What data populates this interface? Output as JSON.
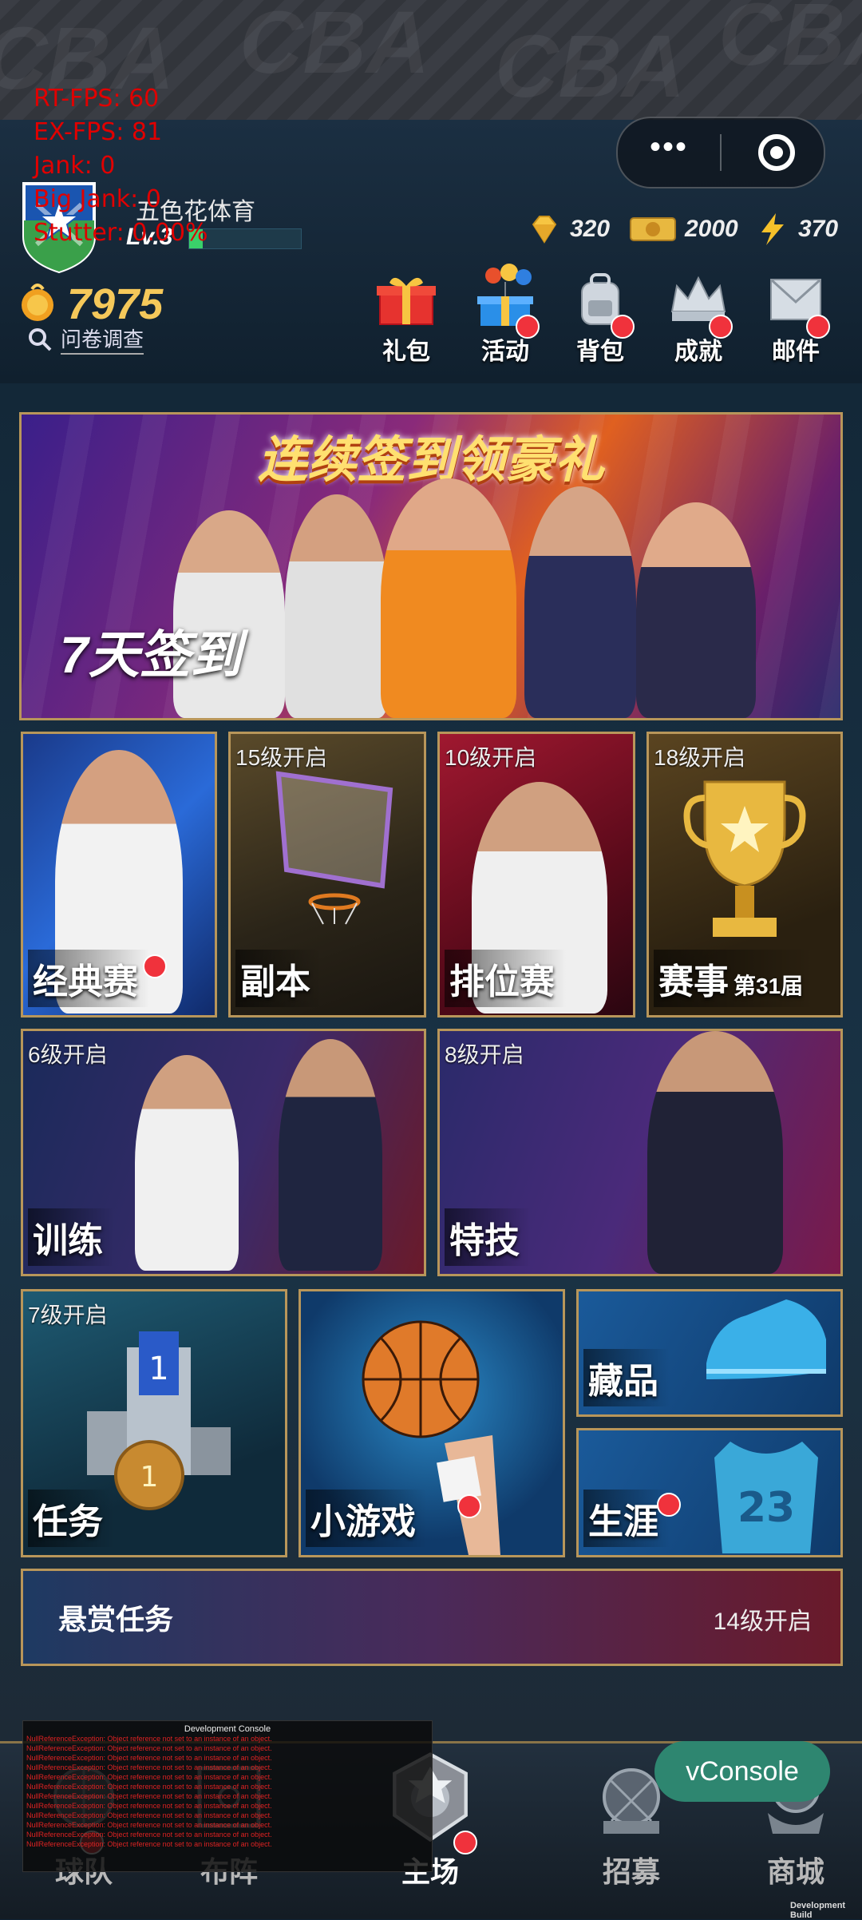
{
  "debug": {
    "rt_fps": "RT-FPS: 60",
    "ex_fps": "EX-FPS: 81",
    "jank": "Jank: 0",
    "big_jank": "Big Jank: 0",
    "stutter": "Stutter: 0.00%"
  },
  "header": {
    "team_name": "五色花体育",
    "level": "Lv.3",
    "xp_fraction": 0.12,
    "resources": [
      {
        "icon": "diamond-icon",
        "value": "320"
      },
      {
        "icon": "ticket-icon",
        "value": "2000"
      },
      {
        "icon": "lightning-icon",
        "value": "370"
      }
    ],
    "coins": "7975",
    "survey_label": "问卷调查"
  },
  "top_nav": [
    {
      "id": "gift",
      "label": "礼包",
      "icon": "gift-icon",
      "badge": false
    },
    {
      "id": "activity",
      "label": "活动",
      "icon": "balloon-gift-icon",
      "badge": true
    },
    {
      "id": "bag",
      "label": "背包",
      "icon": "backpack-icon",
      "badge": true
    },
    {
      "id": "achievement",
      "label": "成就",
      "icon": "crown-icon",
      "badge": true
    },
    {
      "id": "mail",
      "label": "邮件",
      "icon": "mail-icon",
      "badge": true
    }
  ],
  "banner": {
    "title": "连续签到领豪礼",
    "subtitle": "7天签到"
  },
  "tiles": {
    "classic": {
      "label": "经典赛",
      "badge": true
    },
    "dungeon": {
      "label": "副本",
      "lock": "15级开启"
    },
    "ranked": {
      "label": "排位赛",
      "lock": "10级开启"
    },
    "event": {
      "label": "赛事",
      "extra": "第31届",
      "lock": "18级开启"
    },
    "training": {
      "label": "训练",
      "lock": "6级开启"
    },
    "skill": {
      "label": "特技",
      "lock": "8级开启"
    },
    "task": {
      "label": "任务",
      "lock": "7级开启"
    },
    "minigame": {
      "label": "小游戏",
      "badge": true
    },
    "collection": {
      "label": "藏品"
    },
    "career": {
      "label": "生涯",
      "badge": true
    },
    "bounty": {
      "label": "悬赏任务",
      "lock": "14级开启"
    }
  },
  "bottom_tabs": [
    {
      "id": "club",
      "label": "球队",
      "icon": "basketball-crest-icon"
    },
    {
      "id": "lineup",
      "label": "布阵",
      "icon": "court-icon"
    },
    {
      "id": "home",
      "label": "主场",
      "icon": "home-crest-icon"
    },
    {
      "id": "recruit",
      "label": "招募",
      "icon": "recruit-crest-icon"
    },
    {
      "id": "shop",
      "label": "商城",
      "icon": "shop-crest-icon"
    }
  ],
  "dev_console": {
    "title": "Development Console",
    "lines": [
      "NullReferenceException: Object reference not set to an instance of an object.",
      "NullReferenceException: Object reference not set to an instance of an object.",
      "NullReferenceException: Object reference not set to an instance of an object.",
      "NullReferenceException: Object reference not set to an instance of an object.",
      "NullReferenceException: Object reference not set to an instance of an object.",
      "NullReferenceException: Object reference not set to an instance of an object.",
      "NullReferenceException: Object reference not set to an instance of an object.",
      "NullReferenceException: Object reference not set to an instance of an object.",
      "NullReferenceException: Object reference not set to an instance of an object.",
      "NullReferenceException: Object reference not set to an instance of an object.",
      "NullReferenceException: Object reference not set to an instance of an object.",
      "NullReferenceException: Object reference not set to an instance of an object."
    ]
  },
  "vconsole_label": "vConsole",
  "dev_build_label": "Development Build",
  "colors": {
    "gold_border": "#b8965a",
    "red_badge": "#f0323c",
    "vconsole": "#2e8670",
    "coin": "#f5c85a"
  }
}
